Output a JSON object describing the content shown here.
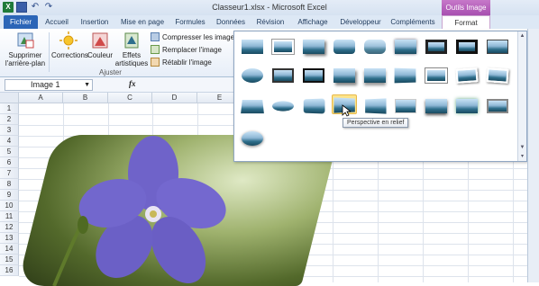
{
  "window": {
    "title": "Classeur1.xlsx - Microsoft Excel",
    "context_tab_group": "Outils Image"
  },
  "tabs": [
    "Fichier",
    "Accueil",
    "Insertion",
    "Mise en page",
    "Formules",
    "Données",
    "Révision",
    "Affichage",
    "Développeur",
    "Compléments",
    "Format"
  ],
  "ribbon": {
    "remove_bg": [
      "Supprimer",
      "l'arrière-plan"
    ],
    "corrections": "Corrections",
    "couleur": "Couleur",
    "effets": [
      "Effets",
      "artistiques"
    ],
    "compress": "Compresser les images",
    "replace": "Remplacer l'image",
    "reset": "Rétablir l'image",
    "group_label": "Ajuster"
  },
  "formula_bar": {
    "name_box": "Image 1",
    "fx": "fx"
  },
  "columns": [
    "A",
    "B",
    "C",
    "D",
    "E"
  ],
  "rows": [
    "1",
    "2",
    "3",
    "4",
    "5",
    "6",
    "7",
    "8",
    "9",
    "10",
    "11",
    "12",
    "13",
    "14",
    "15",
    "16"
  ],
  "gallery": {
    "tooltip": "Perspective en relief",
    "highlighted": "Perspective en relief"
  }
}
